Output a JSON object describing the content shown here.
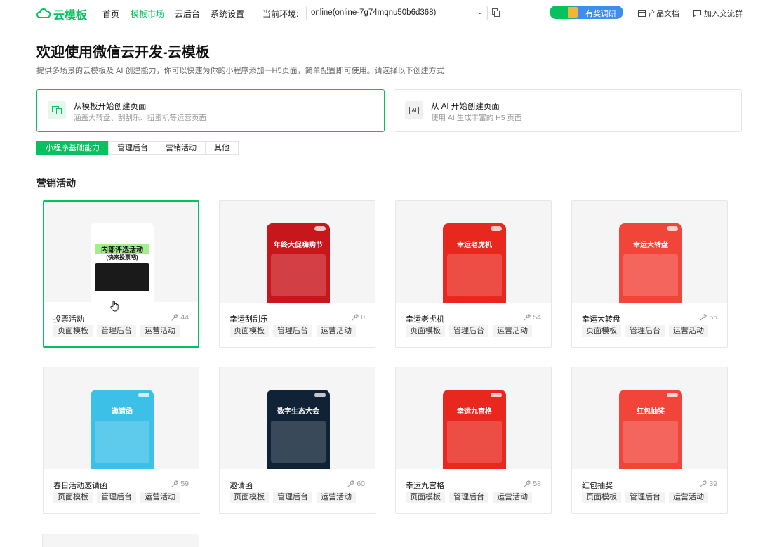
{
  "header": {
    "logo": "云模板",
    "nav": [
      "首页",
      "模板市场",
      "云后台",
      "系统设置"
    ],
    "env_label": "当前环境:",
    "env_value": "online(online-7g74mqnu50b6d368)",
    "survey": "有奖调研",
    "docs": "产品文档",
    "group": "加入交流群"
  },
  "main": {
    "title": "欢迎使用微信云开发-云模板",
    "desc": "提供多场景的云模板及 AI 创建能力，你可以快速为你的小程序添加一H5页面，简单配置即可使用。请选择以下创建方式",
    "create_options": [
      {
        "title": "从模板开始创建页面",
        "sub": "涵盖大转盘、刮刮乐、扭蛋机等运营页面"
      },
      {
        "title": "从 AI 开始创建页面",
        "sub": "使用 AI 生成丰富的 H5 页面",
        "icon_text": "AI"
      }
    ],
    "tabs": [
      "小程序基础能力",
      "管理后台",
      "营销活动",
      "其他"
    ],
    "section": "营销活动"
  },
  "templates": [
    {
      "name": "投票活动",
      "count": "44",
      "tags": [
        "页面模板",
        "管理后台",
        "运营活动"
      ],
      "phone_title": "内部评选活动",
      "phone_sub": "(快来投票吧)",
      "theme": "#1a1a1a"
    },
    {
      "name": "幸运刮刮乐",
      "count": "0",
      "tags": [
        "页面模板",
        "管理后台",
        "运营活动"
      ],
      "phone_title": "年终大促嗨购节",
      "theme": "#c8161d"
    },
    {
      "name": "幸运老虎机",
      "count": "54",
      "tags": [
        "页面模板",
        "管理后台",
        "运营活动"
      ],
      "phone_title": "幸运老虎机",
      "theme": "#e8281e"
    },
    {
      "name": "幸运大转盘",
      "count": "55",
      "tags": [
        "页面模板",
        "管理后台",
        "运营活动"
      ],
      "phone_title": "幸运大转盘",
      "theme": "#f2453a"
    },
    {
      "name": "春日活动邀请函",
      "count": "59",
      "tags": [
        "页面模板",
        "管理后台",
        "运营活动"
      ],
      "phone_title": "邀请函",
      "theme": "#3cc0e8"
    },
    {
      "name": "邀请函",
      "count": "60",
      "tags": [
        "页面模板",
        "管理后台",
        "运营活动"
      ],
      "phone_title": "数字生态大会",
      "theme": "#0f2236"
    },
    {
      "name": "幸运九宫格",
      "count": "58",
      "tags": [
        "页面模板",
        "管理后台",
        "运营活动"
      ],
      "phone_title": "幸运九宫格",
      "theme": "#e8281e"
    },
    {
      "name": "红包抽奖",
      "count": "39",
      "tags": [
        "页面模板",
        "管理后台",
        "运营活动"
      ],
      "phone_title": "红包抽奖",
      "theme": "#f2453a"
    }
  ],
  "colors": {
    "brand": "#07c160",
    "accent": "#3e8ef0"
  }
}
